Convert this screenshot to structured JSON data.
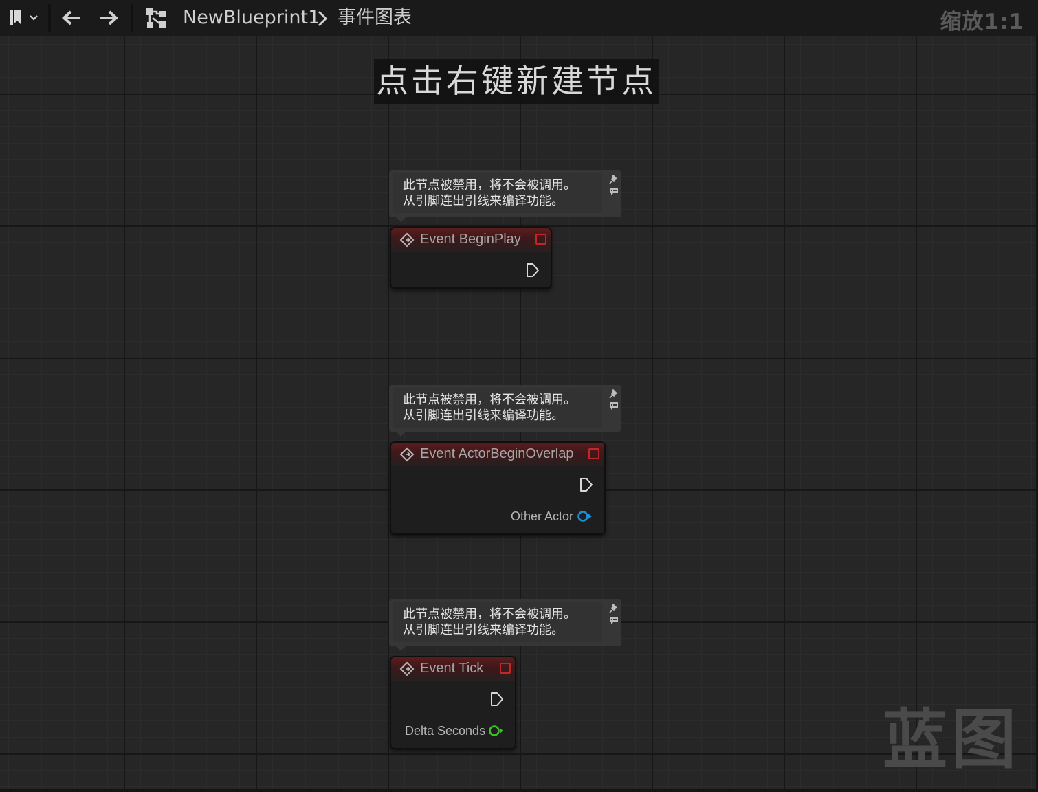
{
  "toolbar": {
    "breadcrumb_blueprint": "NewBlueprint1",
    "breadcrumb_graph": "事件图表",
    "zoom_label": "缩放1:1"
  },
  "graph": {
    "hint": "点击右键新建节点",
    "watermark": "蓝图",
    "disabled_comment_line1": "此节点被禁用，将不会被调用。",
    "disabled_comment_line2": "从引脚连出引线来编译功能。",
    "nodes": [
      {
        "title": "Event BeginPlay",
        "outputs": []
      },
      {
        "title": "Event ActorBeginOverlap",
        "outputs": [
          {
            "label": "Other Actor",
            "type": "object"
          }
        ]
      },
      {
        "title": "Event Tick",
        "outputs": [
          {
            "label": "Delta Seconds",
            "type": "float"
          }
        ]
      }
    ]
  },
  "colors": {
    "node_header": "#5a1d1e",
    "delete_marker": "#c0272b",
    "object_pin": "#1d8fd6",
    "float_pin": "#3fbf2a"
  },
  "icons": {
    "bookmark": "bookmark-icon",
    "back": "back-arrow-icon",
    "forward": "forward-arrow-icon",
    "graph": "graph-icon",
    "event": "event-node-icon"
  }
}
